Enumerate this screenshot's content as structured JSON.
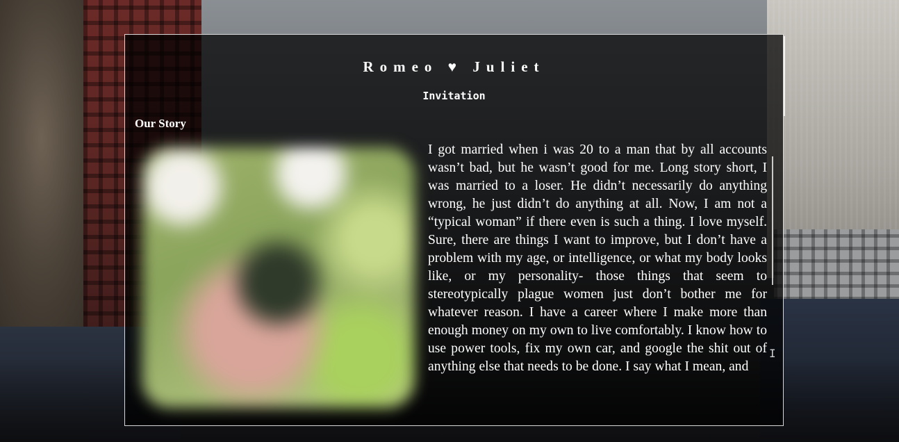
{
  "header": {
    "couple_title": "Romeo ♥ Juliet",
    "subtitle": "Invitation"
  },
  "story": {
    "heading": "Our Story",
    "body": "I got married when i was 20 to a man that by all accounts wasn’t bad, but he wasn’t good for me. Long story short, I was married to a loser. He didn’t necessarily do anything wrong, he just didn’t do anything at all. Now, I am not a “typical woman” if there even is such a thing. I love myself. Sure, there are things I want to improve, but I don’t have a problem with my age, or intelligence, or what my body looks like, or my personality- those things that seem to stereotypically plague women just don’t bother me for whatever reason. I have a career where I make more than enough money on my own to live comfortably. I know how to use power tools, fix my own car, and google the shit out of anything else that needs to be done. I say what I mean, and"
  },
  "colors": {
    "text": "#ffffff",
    "card_border": "#d8d8d8",
    "card_background": "rgba(0,0,0,0.72)"
  }
}
